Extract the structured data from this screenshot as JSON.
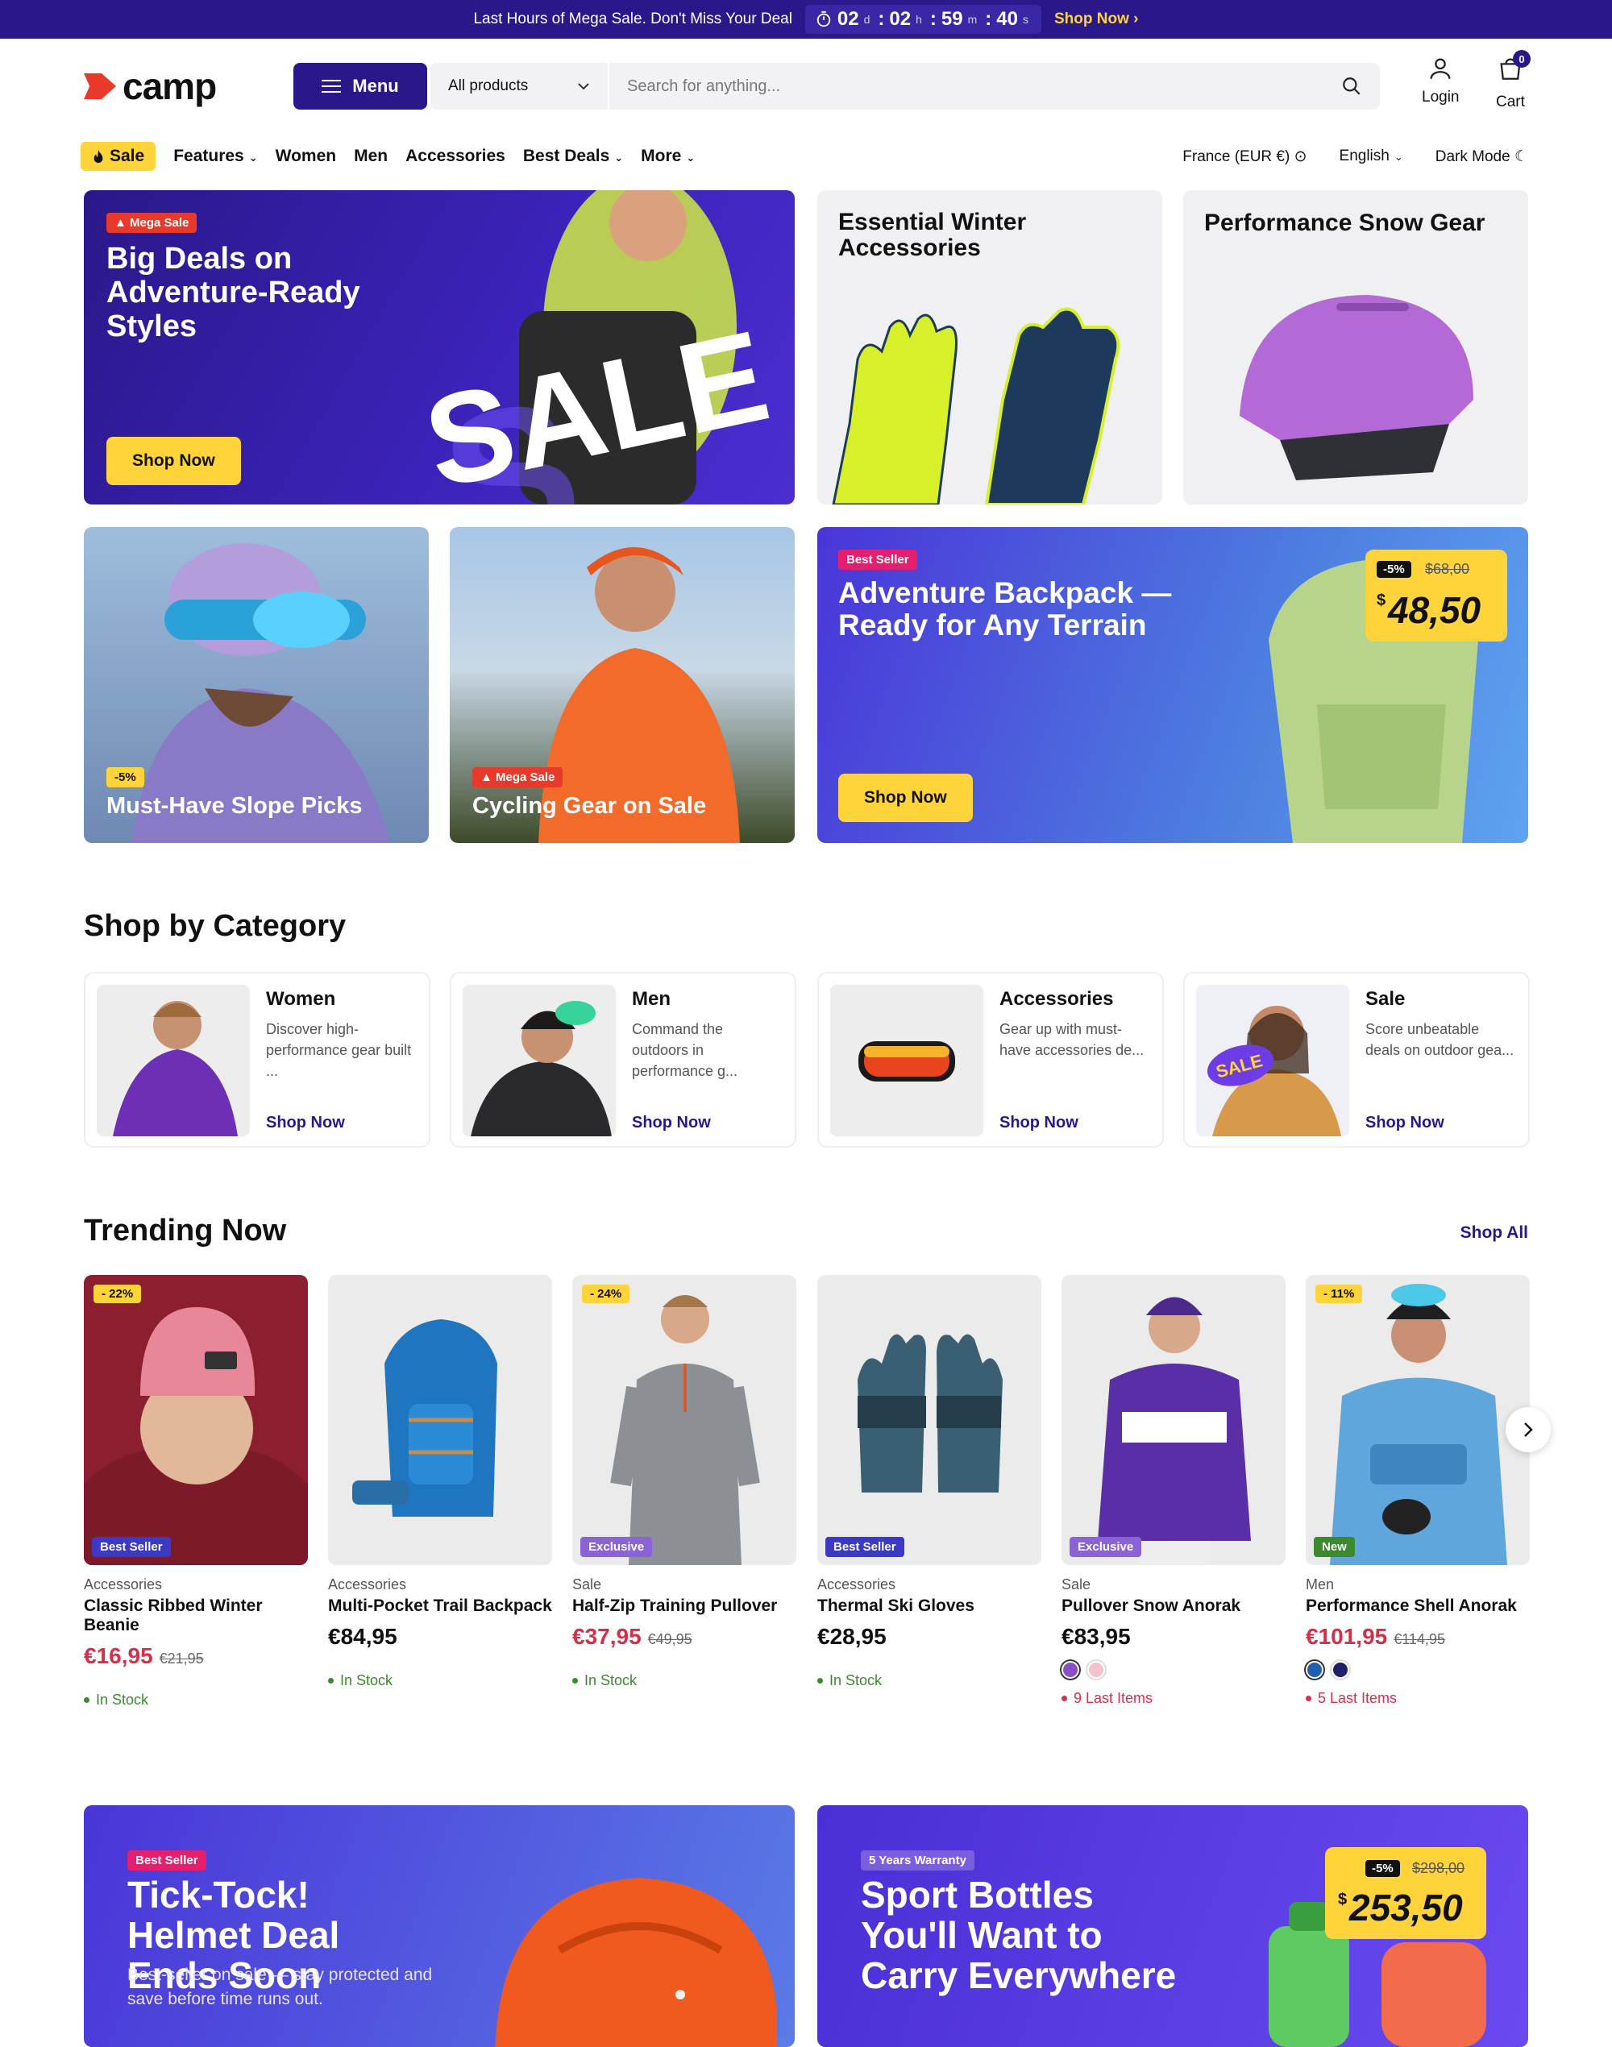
{
  "topbar": {
    "message": "Last Hours of Mega Sale. Don't Miss Your Deal",
    "days": "02",
    "days_unit": "d",
    "hours": "02",
    "hours_unit": "h",
    "minutes": "59",
    "minutes_unit": "m",
    "seconds": "40",
    "seconds_unit": "s",
    "link": "Shop Now"
  },
  "header": {
    "logo": "camp",
    "menu_label": "Menu",
    "category_select": "All products",
    "search_placeholder": "Search for anything...",
    "login_label": "Login",
    "cart_label": "Cart",
    "cart_count": "0"
  },
  "nav": {
    "sale": "Sale",
    "items": [
      "Features",
      "Women",
      "Men",
      "Accessories",
      "Best Deals",
      "More"
    ],
    "region": "France (EUR €)",
    "language": "English",
    "dark_mode": "Dark Mode"
  },
  "hero": {
    "main": {
      "badge": "Mega Sale",
      "title": "Big Deals on Adventure-Ready Styles",
      "cta": "Shop Now",
      "graphic_text": "SALE"
    },
    "winter": {
      "title": "Essential Winter Accessories"
    },
    "snow": {
      "title": "Performance Snow Gear"
    },
    "slope": {
      "badge": "-5%",
      "title": "Must-Have Slope Picks"
    },
    "cycling": {
      "badge": "Mega Sale",
      "title": "Cycling Gear on Sale"
    },
    "backpack": {
      "badge": "Best Seller",
      "title": "Adventure Backpack — Ready for Any Terrain",
      "discount": "-5%",
      "old_price": "$68,00",
      "currency": "$",
      "price": "48,50",
      "cta": "Shop Now"
    }
  },
  "categories": {
    "title": "Shop by Category",
    "items": [
      {
        "name": "Women",
        "desc": "Discover high-performance gear built ...",
        "cta": "Shop Now"
      },
      {
        "name": "Men",
        "desc": "Command the outdoors in performance g...",
        "cta": "Shop Now"
      },
      {
        "name": "Accessories",
        "desc": "Gear up with must-have accessories de...",
        "cta": "Shop Now"
      },
      {
        "name": "Sale",
        "desc": "Score unbeatable deals on outdoor gea...",
        "cta": "Shop Now",
        "img_label": "SALE"
      }
    ]
  },
  "trending": {
    "title": "Trending Now",
    "shop_all": "Shop All",
    "products": [
      {
        "discount": "- 22%",
        "tag": "Best Seller",
        "category": "Accessories",
        "name": "Classic Ribbed Winter Beanie",
        "price": "€16,95",
        "old_price": "€21,95",
        "stock": "In Stock"
      },
      {
        "discount": "",
        "tag": "",
        "category": "Accessories",
        "name": "Multi-Pocket Trail Backpack",
        "price": "€84,95",
        "old_price": "",
        "stock": "In Stock"
      },
      {
        "discount": "- 24%",
        "tag": "Exclusive",
        "category": "Sale",
        "name": "Half-Zip Training Pullover",
        "price": "€37,95",
        "old_price": "€49,95",
        "stock": "In Stock"
      },
      {
        "discount": "",
        "tag": "Best Seller",
        "category": "Accessories",
        "name": "Thermal Ski Gloves",
        "price": "€28,95",
        "old_price": "",
        "stock": "In Stock"
      },
      {
        "discount": "",
        "tag": "Exclusive",
        "category": "Sale",
        "name": "Pullover Snow Anorak",
        "price": "€83,95",
        "old_price": "",
        "stock": "9 Last Items"
      },
      {
        "discount": "- 11%",
        "tag": "New",
        "category": "Men",
        "name": "Performance Shell Anorak",
        "price": "€101,95",
        "old_price": "€114,95",
        "stock": "5 Last Items"
      }
    ]
  },
  "promos": {
    "helmet": {
      "badge": "Best Seller",
      "title": "Tick-Tock! Helmet Deal Ends Soon",
      "subtitle": "Best-seller on sale — stay protected and save before time runs out."
    },
    "bottles": {
      "badge": "5 Years Warranty",
      "title": "Sport Bottles You'll Want to Carry Everywhere",
      "discount": "-5%",
      "old_price": "$298,00",
      "currency": "$",
      "price": "253,50"
    }
  },
  "colors": {
    "brand": "#2a188a",
    "accent_yellow": "#ffd43b",
    "sale_red": "#d3304a",
    "stock_green": "#3c8a2e"
  }
}
